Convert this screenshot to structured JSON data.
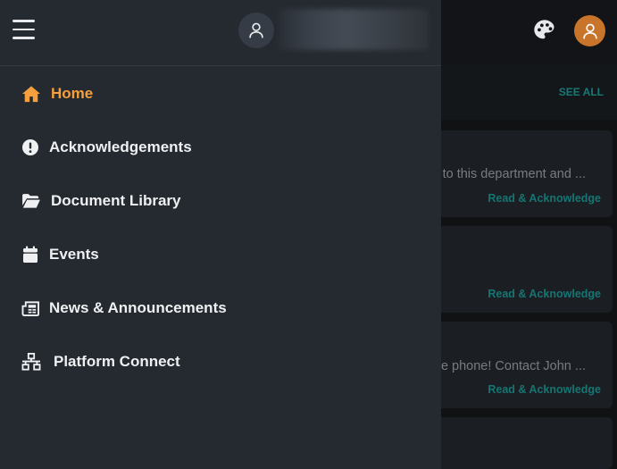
{
  "colors": {
    "accent": "#f5a03c",
    "link": "#1fa39f",
    "drawer_bg": "#252a31",
    "avatar_orange": "#c8742a"
  },
  "header": {
    "menu_icon": "hamburger-menu-icon",
    "palette_icon": "palette-icon",
    "user_icon": "user-icon"
  },
  "nav": {
    "items": [
      {
        "label": "Home",
        "icon": "home-icon",
        "active": true
      },
      {
        "label": "Acknowledgements",
        "icon": "exclamation-circle-icon"
      },
      {
        "label": "Document Library",
        "icon": "folder-open-icon"
      },
      {
        "label": "Events",
        "icon": "calendar-icon"
      },
      {
        "label": "News & Announcements",
        "icon": "newspaper-icon"
      },
      {
        "label": "Platform Connect",
        "icon": "network-icon"
      }
    ]
  },
  "main": {
    "see_all": "SEE ALL",
    "cards": [
      {
        "text": "e to this department and ...",
        "link": "Read & Acknowledge"
      },
      {
        "text": "",
        "link": "Read & Acknowledge"
      },
      {
        "text": "bile phone! Contact John ...",
        "link": "Read & Acknowledge"
      }
    ]
  }
}
